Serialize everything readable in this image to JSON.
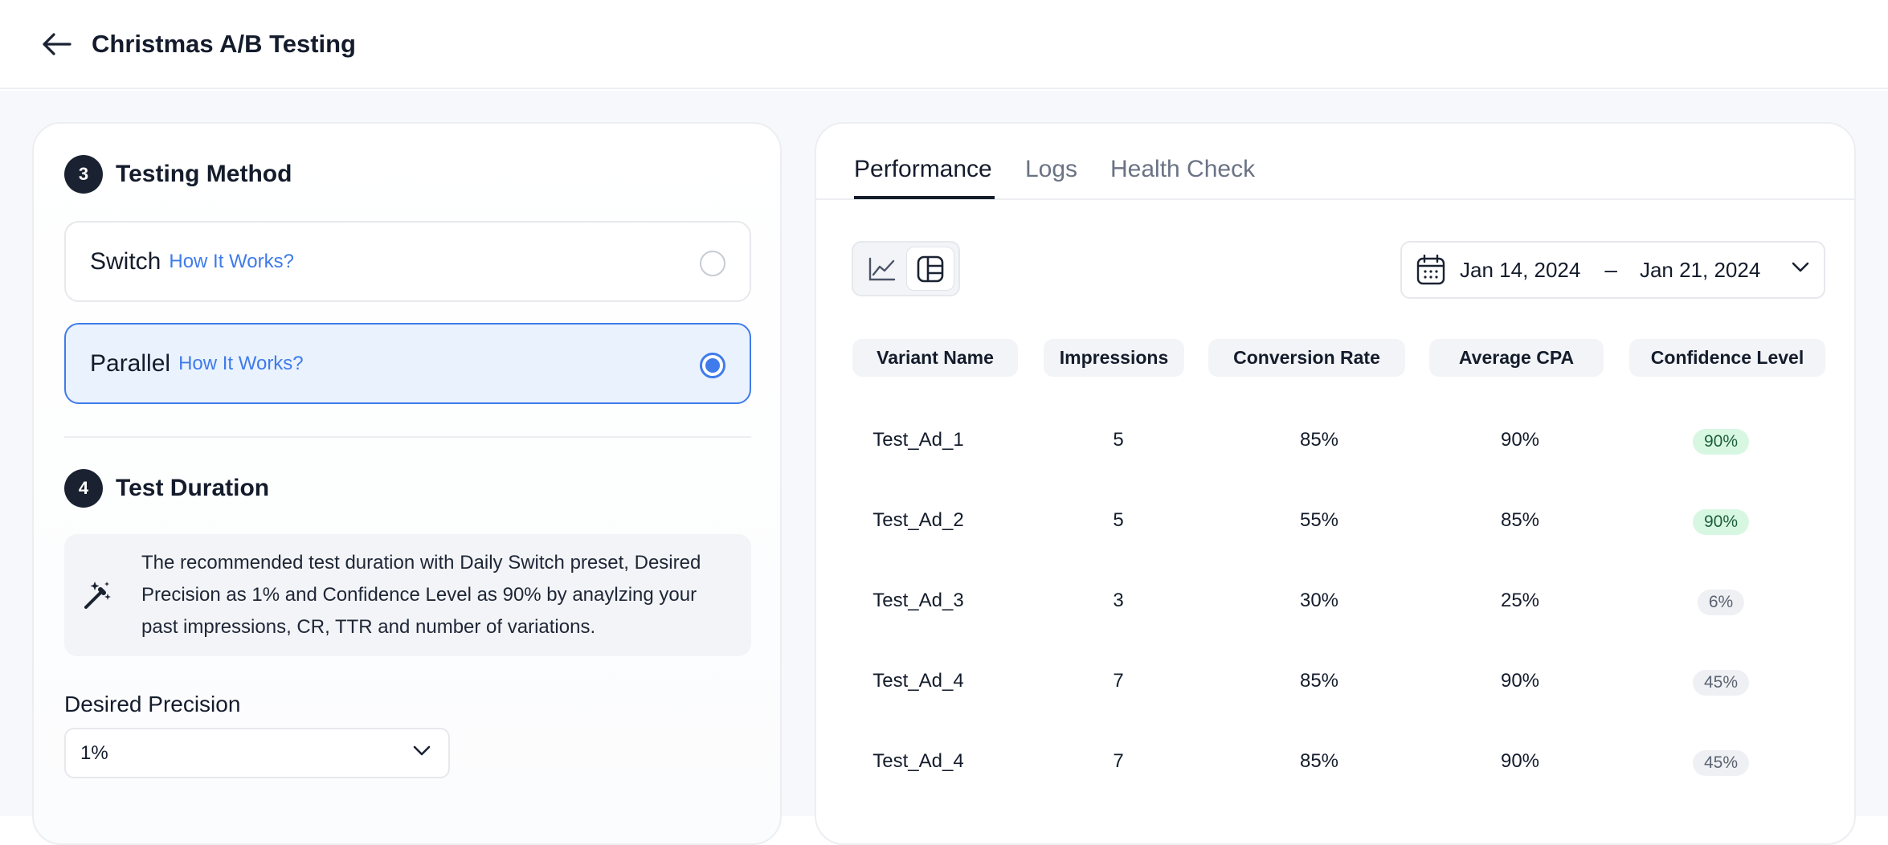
{
  "header": {
    "title": "Christmas A/B Testing"
  },
  "testing_method": {
    "step": "3",
    "title": "Testing Method",
    "options": [
      {
        "label": "Switch",
        "link": "How It Works?",
        "selected": false
      },
      {
        "label": "Parallel",
        "link": "How It Works?",
        "selected": true
      }
    ]
  },
  "test_duration": {
    "step": "4",
    "title": "Test Duration",
    "recommendation_lines": [
      "The recommended test duration with Daily Switch preset, Desired",
      "Precision as 1% and Confidence Level as 90% by anaylzing your",
      "past impressions, CR, TTR and number of variations."
    ],
    "precision_label": "Desired Precision",
    "precision_value": "1%"
  },
  "tabs": [
    {
      "label": "Performance",
      "active": true
    },
    {
      "label": "Logs",
      "active": false
    },
    {
      "label": "Health Check",
      "active": false
    }
  ],
  "view_toggle": {
    "active": "table",
    "options": [
      "line-chart",
      "table"
    ]
  },
  "date_range": {
    "start": "Jan 14, 2024",
    "separator": "–",
    "end": "Jan 21, 2024"
  },
  "table": {
    "columns": [
      "Variant Name",
      "Impressions",
      "Conversion Rate",
      "Average CPA",
      "Confidence Level"
    ],
    "rows": [
      {
        "name": "Test_Ad_1",
        "impressions": "5",
        "conversion_rate": "85%",
        "average_cpa": "90%",
        "confidence": "90%",
        "level": "high"
      },
      {
        "name": "Test_Ad_2",
        "impressions": "5",
        "conversion_rate": "55%",
        "average_cpa": "85%",
        "confidence": "90%",
        "level": "high"
      },
      {
        "name": "Test_Ad_3",
        "impressions": "3",
        "conversion_rate": "30%",
        "average_cpa": "25%",
        "confidence": "6%",
        "level": "low"
      },
      {
        "name": "Test_Ad_4",
        "impressions": "7",
        "conversion_rate": "85%",
        "average_cpa": "90%",
        "confidence": "45%",
        "level": "low"
      },
      {
        "name": "Test_Ad_4",
        "impressions": "7",
        "conversion_rate": "85%",
        "average_cpa": "90%",
        "confidence": "45%",
        "level": "low"
      }
    ]
  },
  "colors": {
    "accent": "#3f7bea",
    "selected_bg": "#eaf2fe",
    "badge_dark": "#1a2232",
    "confidence_high_bg": "#d7f7e3",
    "confidence_low_bg": "#eef0f3"
  },
  "icons": [
    "back-arrow-icon",
    "magic-wand-icon",
    "chevron-down-icon",
    "line-chart-icon",
    "table-layout-icon",
    "calendar-icon"
  ]
}
